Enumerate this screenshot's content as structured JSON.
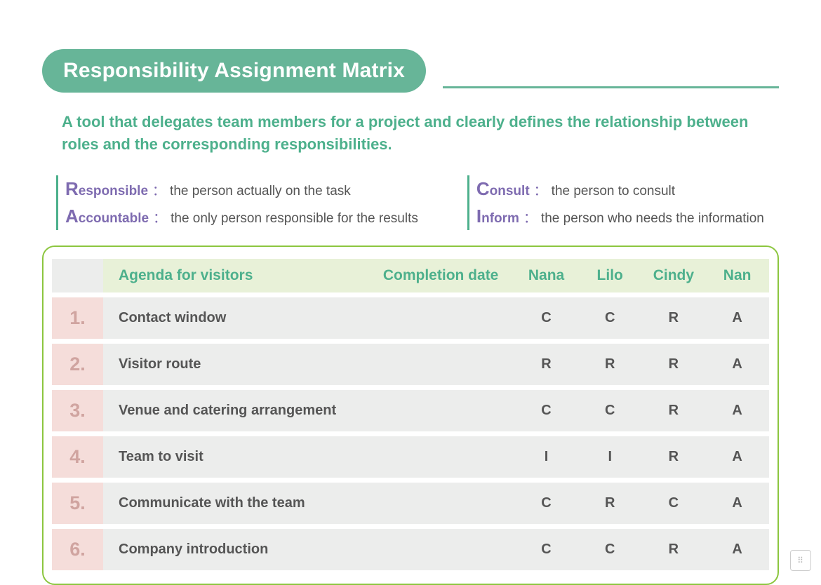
{
  "title": "Responsibility Assignment Matrix",
  "subtitle": "A tool that delegates team members for a project and clearly defines the relationship between roles and the corresponding responsibilities.",
  "legend": [
    {
      "lead": "R",
      "rest": "esponsible",
      "desc": "the person actually on the task"
    },
    {
      "lead": "A",
      "rest": "ccountable",
      "desc": "the only person responsible for the results"
    },
    {
      "lead": "C",
      "rest": "onsult",
      "desc": "the person to consult"
    },
    {
      "lead": "I",
      "rest": "nform",
      "desc": "the person who needs the information"
    }
  ],
  "columns": {
    "agenda": "Agenda for visitors",
    "date": "Completion date",
    "people": [
      "Nana",
      "Lilo",
      "Cindy",
      "Nan"
    ]
  },
  "rows": [
    {
      "num": "1.",
      "task": "Contact window",
      "date": "",
      "vals": [
        "C",
        "C",
        "R",
        "A"
      ]
    },
    {
      "num": "2.",
      "task": "Visitor route",
      "date": "",
      "vals": [
        "R",
        "R",
        "R",
        "A"
      ]
    },
    {
      "num": "3.",
      "task": "Venue and catering arrangement",
      "date": "",
      "vals": [
        "C",
        "C",
        "R",
        "A"
      ]
    },
    {
      "num": "4.",
      "task": "Team to visit",
      "date": "",
      "vals": [
        "I",
        "I",
        "R",
        "A"
      ]
    },
    {
      "num": "5.",
      "task": "Communicate with the team",
      "date": "",
      "vals": [
        "C",
        "R",
        "C",
        "A"
      ]
    },
    {
      "num": "6.",
      "task": "Company introduction",
      "date": "",
      "vals": [
        "C",
        "C",
        "R",
        "A"
      ]
    }
  ],
  "chart_data": {
    "type": "table",
    "title": "Responsibility Assignment Matrix",
    "columns": [
      "Agenda for visitors",
      "Completion date",
      "Nana",
      "Lilo",
      "Cindy",
      "Nan"
    ],
    "rows": [
      [
        "Contact window",
        "",
        "C",
        "C",
        "R",
        "A"
      ],
      [
        "Visitor route",
        "",
        "R",
        "R",
        "R",
        "A"
      ],
      [
        "Venue and catering arrangement",
        "",
        "C",
        "C",
        "R",
        "A"
      ],
      [
        "Team to visit",
        "",
        "I",
        "I",
        "R",
        "A"
      ],
      [
        "Communicate with the team",
        "",
        "C",
        "R",
        "C",
        "A"
      ],
      [
        "Company introduction",
        "",
        "C",
        "C",
        "R",
        "A"
      ]
    ],
    "legend": {
      "R": "Responsible",
      "A": "Accountable",
      "C": "Consult",
      "I": "Inform"
    }
  }
}
